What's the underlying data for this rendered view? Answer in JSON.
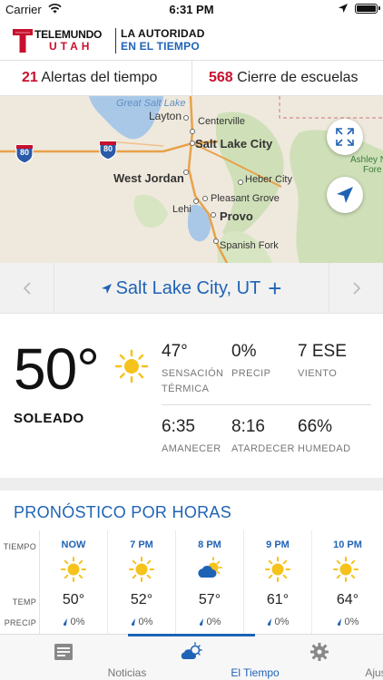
{
  "status_bar": {
    "carrier": "Carrier",
    "time": "6:31 PM"
  },
  "brand": {
    "line1": "TELEMUNDO",
    "line2": "UTAH",
    "slogan1": "LA AUTORIDAD",
    "slogan2": "EN EL TIEMPO"
  },
  "alerts": {
    "weather_count": "21",
    "weather_label": "Alertas del tiempo",
    "schools_count": "568",
    "schools_label": "Cierre de escuelas"
  },
  "map": {
    "labels": {
      "great_salt_lake": "Great Salt Lake",
      "layton": "Layton",
      "centerville": "Centerville",
      "salt_lake_city": "Salt Lake City",
      "west_jordan": "West Jordan",
      "heber_city": "Heber City",
      "pleasant_grove": "Pleasant Grove",
      "lehi": "Lehi",
      "provo": "Provo",
      "spanish_fork": "Spanish Fork",
      "ashley_1": "Ashley N",
      "ashley_2": "Fore",
      "hwy_80_a": "80",
      "hwy_80_b": "80"
    }
  },
  "location": {
    "city": "Salt Lake City, UT",
    "add": "+"
  },
  "current": {
    "temperature": "50°",
    "condition": "SOLEADO",
    "icon": "sun-icon",
    "stats": [
      {
        "value": "47°",
        "label": "SENSACIÓN TÉRMICA"
      },
      {
        "value": "0%",
        "label": "PRECIP"
      },
      {
        "value": "7 ESE",
        "label": "VIENTO"
      },
      {
        "value": "6:35",
        "label": "AMANECER"
      },
      {
        "value": "8:16",
        "label": "ATARDECER"
      },
      {
        "value": "66%",
        "label": "HUMEDAD"
      }
    ]
  },
  "hourly": {
    "title": "PRONÓSTICO POR HORAS",
    "row_labels": {
      "time": "TIEMPO",
      "temp": "TEMP",
      "precip": "PRECIP"
    },
    "hours": [
      {
        "time": "NOW",
        "icon": "sun-icon",
        "temp": "50°",
        "precip": "0%"
      },
      {
        "time": "7 PM",
        "icon": "sun-icon",
        "temp": "52°",
        "precip": "0%"
      },
      {
        "time": "8 PM",
        "icon": "partly-cloudy-icon",
        "temp": "57°",
        "precip": "0%"
      },
      {
        "time": "9 PM",
        "icon": "sun-icon",
        "temp": "61°",
        "precip": "0%"
      },
      {
        "time": "10 PM",
        "icon": "sun-icon",
        "temp": "64°",
        "precip": "0%"
      }
    ]
  },
  "tabs": [
    {
      "label": "Noticias",
      "icon": "news-icon",
      "active": false
    },
    {
      "label": "El Tiempo",
      "icon": "weather-icon",
      "active": true
    },
    {
      "label": "Ajustes",
      "icon": "gear-icon",
      "active": false
    }
  ],
  "colors": {
    "brand_blue": "#1f63b5",
    "alert_red": "#c8102e",
    "sun_yellow": "#f6c21c"
  }
}
